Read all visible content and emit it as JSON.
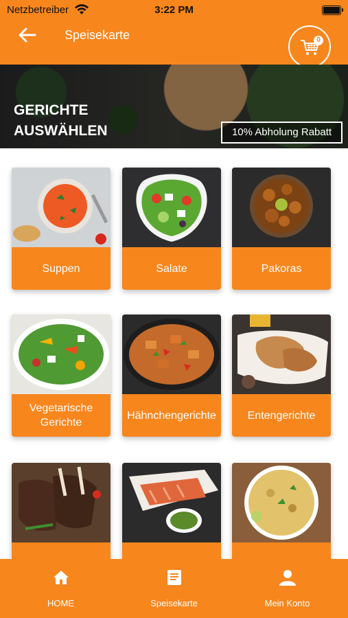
{
  "status_bar": {
    "carrier": "Netzbetreiber",
    "time": "3:22 PM"
  },
  "header": {
    "title": "Speisekarte",
    "cart_count": "0"
  },
  "banner": {
    "title": "GERICHTE AUSWÄHLEN",
    "discount": "10% Abholung Rabatt"
  },
  "categories": [
    {
      "label": "Suppen"
    },
    {
      "label": "Salate"
    },
    {
      "label": "Pakoras"
    },
    {
      "label": "Vegetarische Gerichte"
    },
    {
      "label": "Hähnchengerichte"
    },
    {
      "label": "Entengerichte"
    },
    {
      "label": ""
    },
    {
      "label": ""
    },
    {
      "label": ""
    }
  ],
  "bottom_nav": [
    {
      "label": "HOME",
      "icon": "home-icon"
    },
    {
      "label": "Speisekarte",
      "icon": "menu-icon"
    },
    {
      "label": "Mein Konto",
      "icon": "account-icon"
    }
  ],
  "colors": {
    "accent": "#f7861d",
    "text_on_accent": "#ffffff"
  }
}
